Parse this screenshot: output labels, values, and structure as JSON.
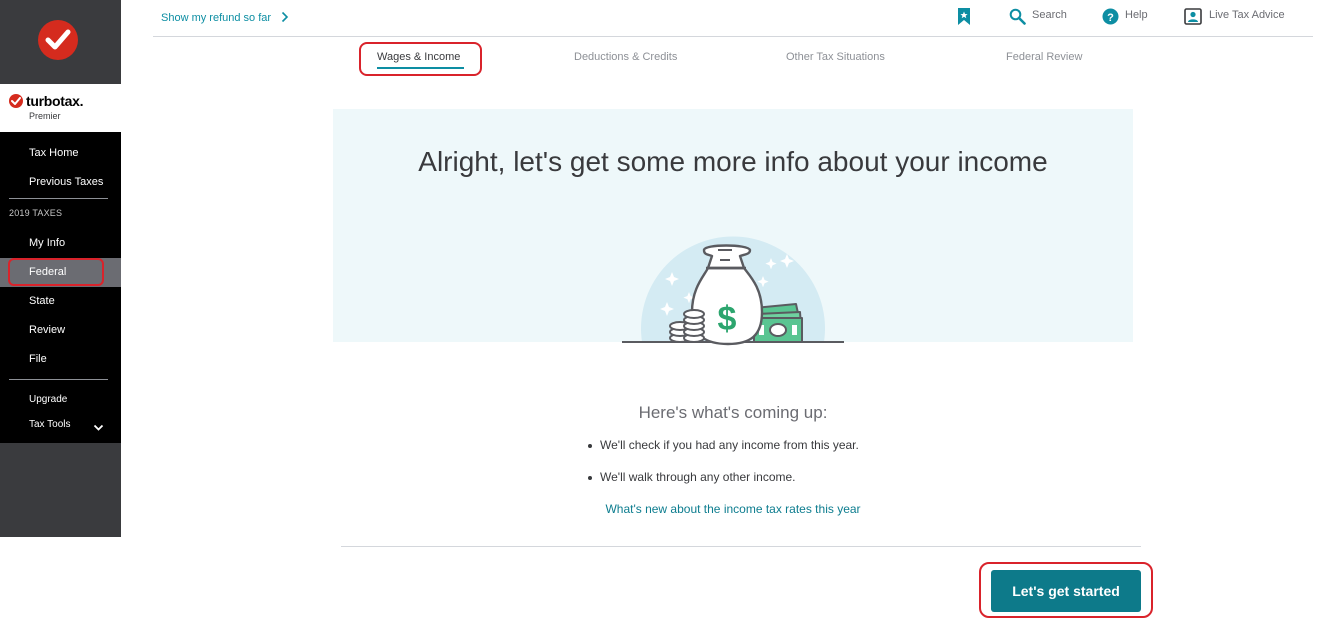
{
  "sidebar": {
    "brand_name": "turbotax",
    "brand_dot": ".",
    "edition": "Premier",
    "items": [
      {
        "label": "Tax Home"
      },
      {
        "label": "Previous Taxes"
      },
      {
        "label": "My Info"
      },
      {
        "label": "Federal"
      },
      {
        "label": "State"
      },
      {
        "label": "Review"
      },
      {
        "label": "File"
      }
    ],
    "section_label": "2019 TAXES",
    "upgrade_label": "Upgrade",
    "tax_tools_label": "Tax Tools",
    "active_item": "Federal"
  },
  "header": {
    "refund_link": "Show my refund so far",
    "search_label": "Search",
    "help_label": "Help",
    "live_advice_label": "Live Tax Advice"
  },
  "steps": [
    {
      "label": "Wages & Income"
    },
    {
      "label": "Deductions & Credits"
    },
    {
      "label": "Other Tax Situations"
    },
    {
      "label": "Federal Review"
    }
  ],
  "hero": {
    "title": "Alright, let's get some more info about your income"
  },
  "coming_up": {
    "title": "Here's what's coming up:",
    "bullets": [
      "We'll check if you had any income from this year.",
      "We'll walk through any other income."
    ],
    "link": "What's new about the income tax rates this year"
  },
  "cta": {
    "label": "Let's get started"
  },
  "colors": {
    "accent": "#0d8ea3",
    "button": "#0d7a8a",
    "brand_red": "#d52b1e",
    "annotation": "#d9232b"
  },
  "icons": {
    "logo": "checkmark-icon",
    "bookmark": "bookmark-icon",
    "search": "search-icon",
    "help": "help-icon",
    "live_advice": "expert-icon",
    "tools_toggle": "chevron-down-icon"
  }
}
